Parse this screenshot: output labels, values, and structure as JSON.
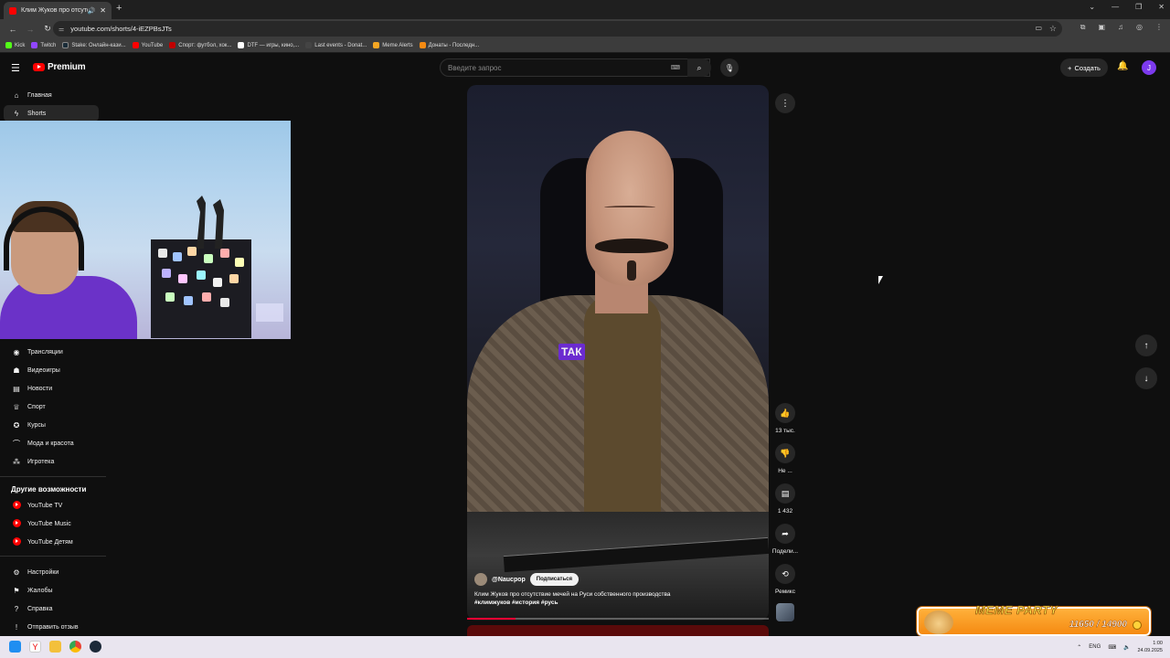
{
  "browser": {
    "tab_title": "Клим Жуков про отсутстви",
    "url": "youtube.com/shorts/4-iEZPBsJTs",
    "bookmarks": [
      {
        "label": "Kick",
        "color": "#53fc18"
      },
      {
        "label": "Twitch",
        "color": "#9146ff"
      },
      {
        "label": "Stake: Онлайн-кази...",
        "color": "#1a2c38"
      },
      {
        "label": "YouTube",
        "color": "#ff0000"
      },
      {
        "label": "Спорт: футбол, хок...",
        "color": "#c00000"
      },
      {
        "label": "DTF — игры, кино,...",
        "color": "#ffffff"
      },
      {
        "label": "Last events - Donat...",
        "color": "#444444"
      },
      {
        "label": "Meme Alerts",
        "color": "#f5a623"
      },
      {
        "label": "Донаты - Последн...",
        "color": "#f58a12"
      }
    ]
  },
  "masthead": {
    "logo_text": "Premium",
    "search_placeholder": "Введите запрос",
    "create_label": "Создать",
    "avatar_letter": "J"
  },
  "sidebar": {
    "top_items": [
      {
        "label": "Главная",
        "icon": "home-icon",
        "glyph": "⌂"
      },
      {
        "label": "Shorts",
        "icon": "shorts-icon",
        "glyph": "ϟ"
      }
    ],
    "explore_items": [
      {
        "label": "Трансляции",
        "icon": "live-icon",
        "glyph": "◉"
      },
      {
        "label": "Видеоигры",
        "icon": "gamepad-icon",
        "glyph": "☗"
      },
      {
        "label": "Новости",
        "icon": "news-icon",
        "glyph": "▤"
      },
      {
        "label": "Спорт",
        "icon": "trophy-icon",
        "glyph": "♕"
      },
      {
        "label": "Курсы",
        "icon": "bulb-icon",
        "glyph": "✪"
      },
      {
        "label": "Мода и красота",
        "icon": "hanger-icon",
        "glyph": "⌒"
      },
      {
        "label": "Игротека",
        "icon": "grid-icon",
        "glyph": "⁂"
      }
    ],
    "more_heading": "Другие возможности",
    "more_items": [
      {
        "label": "YouTube TV"
      },
      {
        "label": "YouTube Music"
      },
      {
        "label": "YouTube Детям"
      }
    ],
    "bottom_items": [
      {
        "label": "Настройки",
        "icon": "gear-icon",
        "glyph": "⚙"
      },
      {
        "label": "Жалобы",
        "icon": "flag-icon",
        "glyph": "⚑"
      },
      {
        "label": "Справка",
        "icon": "help-icon",
        "glyph": "?"
      },
      {
        "label": "Отправить отзыв",
        "icon": "feedback-icon",
        "glyph": "!"
      }
    ]
  },
  "video": {
    "caption_overlay": "ТАК",
    "channel": "@Naucpop",
    "subscribe_label": "Подписаться",
    "title": "Клим Жуков про отсутствие мечей на Руси собственного производства",
    "hashtags": "#климжуков #история #русь",
    "progress": 0.16
  },
  "actions": {
    "likes": "13 тыс.",
    "dislike": "Не ...",
    "comments": "1 432",
    "share": "Подели...",
    "remix": "Ремикс"
  },
  "overlay": {
    "title": "MEME PARTY",
    "counter": "11650 / 14900"
  },
  "taskbar": {
    "lang": "ENG",
    "time": "1:00",
    "date": "24.09.2025"
  }
}
